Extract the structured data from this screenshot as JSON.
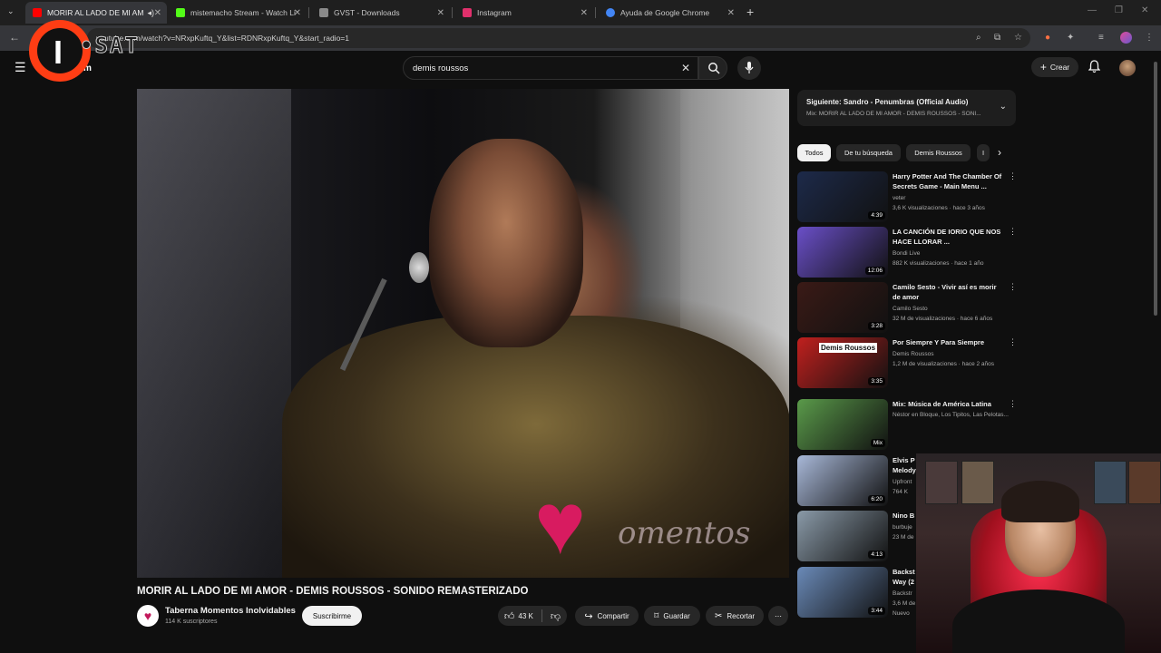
{
  "browser": {
    "tabs": [
      {
        "label": "MORIR AL LADO DE MI AM",
        "favicon_color": "#ff0000",
        "active": true
      },
      {
        "label": "mistemacho Stream - Watch Li",
        "favicon_color": "#53fc18",
        "active": false
      },
      {
        "label": "GVST - Downloads",
        "favicon_color": "#8a8a8a",
        "active": false
      },
      {
        "label": "Instagram",
        "favicon_color": "#e1306c",
        "active": false
      },
      {
        "label": "Ayuda de Google Chrome",
        "favicon_color": "#4285f4",
        "active": false
      }
    ],
    "url": "youtube.com/watch?v=NRxpKuftq_Y&list=RDNRxpKuftq_Y&start_radio=1"
  },
  "overlay": {
    "logo_letter": "I",
    "logo_text": "•SAT"
  },
  "header": {
    "logo_text": "m",
    "search_query": "demis roussos",
    "create_label": "Crear"
  },
  "video": {
    "watermark": "omentos",
    "title": "MORIR AL LADO DE MI AMOR - DEMIS ROUSSOS - SONIDO REMASTERIZADO",
    "channel_name": "Taberna Momentos Inolvidables",
    "subscribers": "114 K suscriptores",
    "subscribe_label": "Suscribirme",
    "likes": "43 K",
    "share_label": "Compartir",
    "save_label": "Guardar",
    "clip_label": "Recortar"
  },
  "sidebar": {
    "upnext_title": "Siguiente: Sandro - Penumbras (Official Audio)",
    "upnext_sub": "Mix: MORIR AL LADO DE MI AMOR - DEMIS ROUSSOS - SONI...",
    "chips": [
      "Todos",
      "De tu búsqueda",
      "Demis Roussos",
      "I"
    ],
    "recommendations": [
      {
        "title": "Harry Potter And The Chamber Of Secrets Game - Main Menu ...",
        "channel": "veter",
        "meta": "3,6 K visualizaciones · hace 3 años",
        "duration": "4:39",
        "thumb_color": "#1d2a4a"
      },
      {
        "title": "LA CANCIÓN DE IORIO QUE NOS HACE LLORAR ...",
        "channel": "Bondi Live",
        "meta": "882 K visualizaciones · hace 1 año",
        "duration": "12:06",
        "thumb_color": "#6a4fc8"
      },
      {
        "title": "Camilo Sesto - Vivir así es morir de amor",
        "channel": "Camilo Sesto",
        "meta": "32 M de visualizaciones · hace 6 años",
        "duration": "3:28",
        "thumb_color": "#3a1a16"
      },
      {
        "title": "Por Siempre Y Para Siempre",
        "channel": "Demis Roussos",
        "meta": "1,2 M de visualizaciones · hace 2 años",
        "duration": "3:35",
        "thumb_color": "#c0201e",
        "thumb_label": "Demis Roussos"
      },
      {
        "title": "Mix: Música de América Latina",
        "channel": "Néstor en Bloque, Los Tipitos, Las Pelotas...",
        "meta": "",
        "duration": "Mix",
        "thumb_color": "#5a9a4a"
      },
      {
        "title": "Elvis P Melody",
        "channel": "Upfront",
        "meta": "764 K",
        "duration": "6:20",
        "thumb_color": "#a8b8d8"
      },
      {
        "title": "Nino B",
        "channel": "burbuje",
        "meta": "23 M de",
        "duration": "4:13",
        "thumb_color": "#8a9aa8"
      },
      {
        "title": "Backst Way (2",
        "channel": "Backstr",
        "meta": "3,6 M de",
        "duration": "3:44",
        "thumb_color": "#6a8ab8",
        "extra": "Nuevo"
      }
    ]
  }
}
